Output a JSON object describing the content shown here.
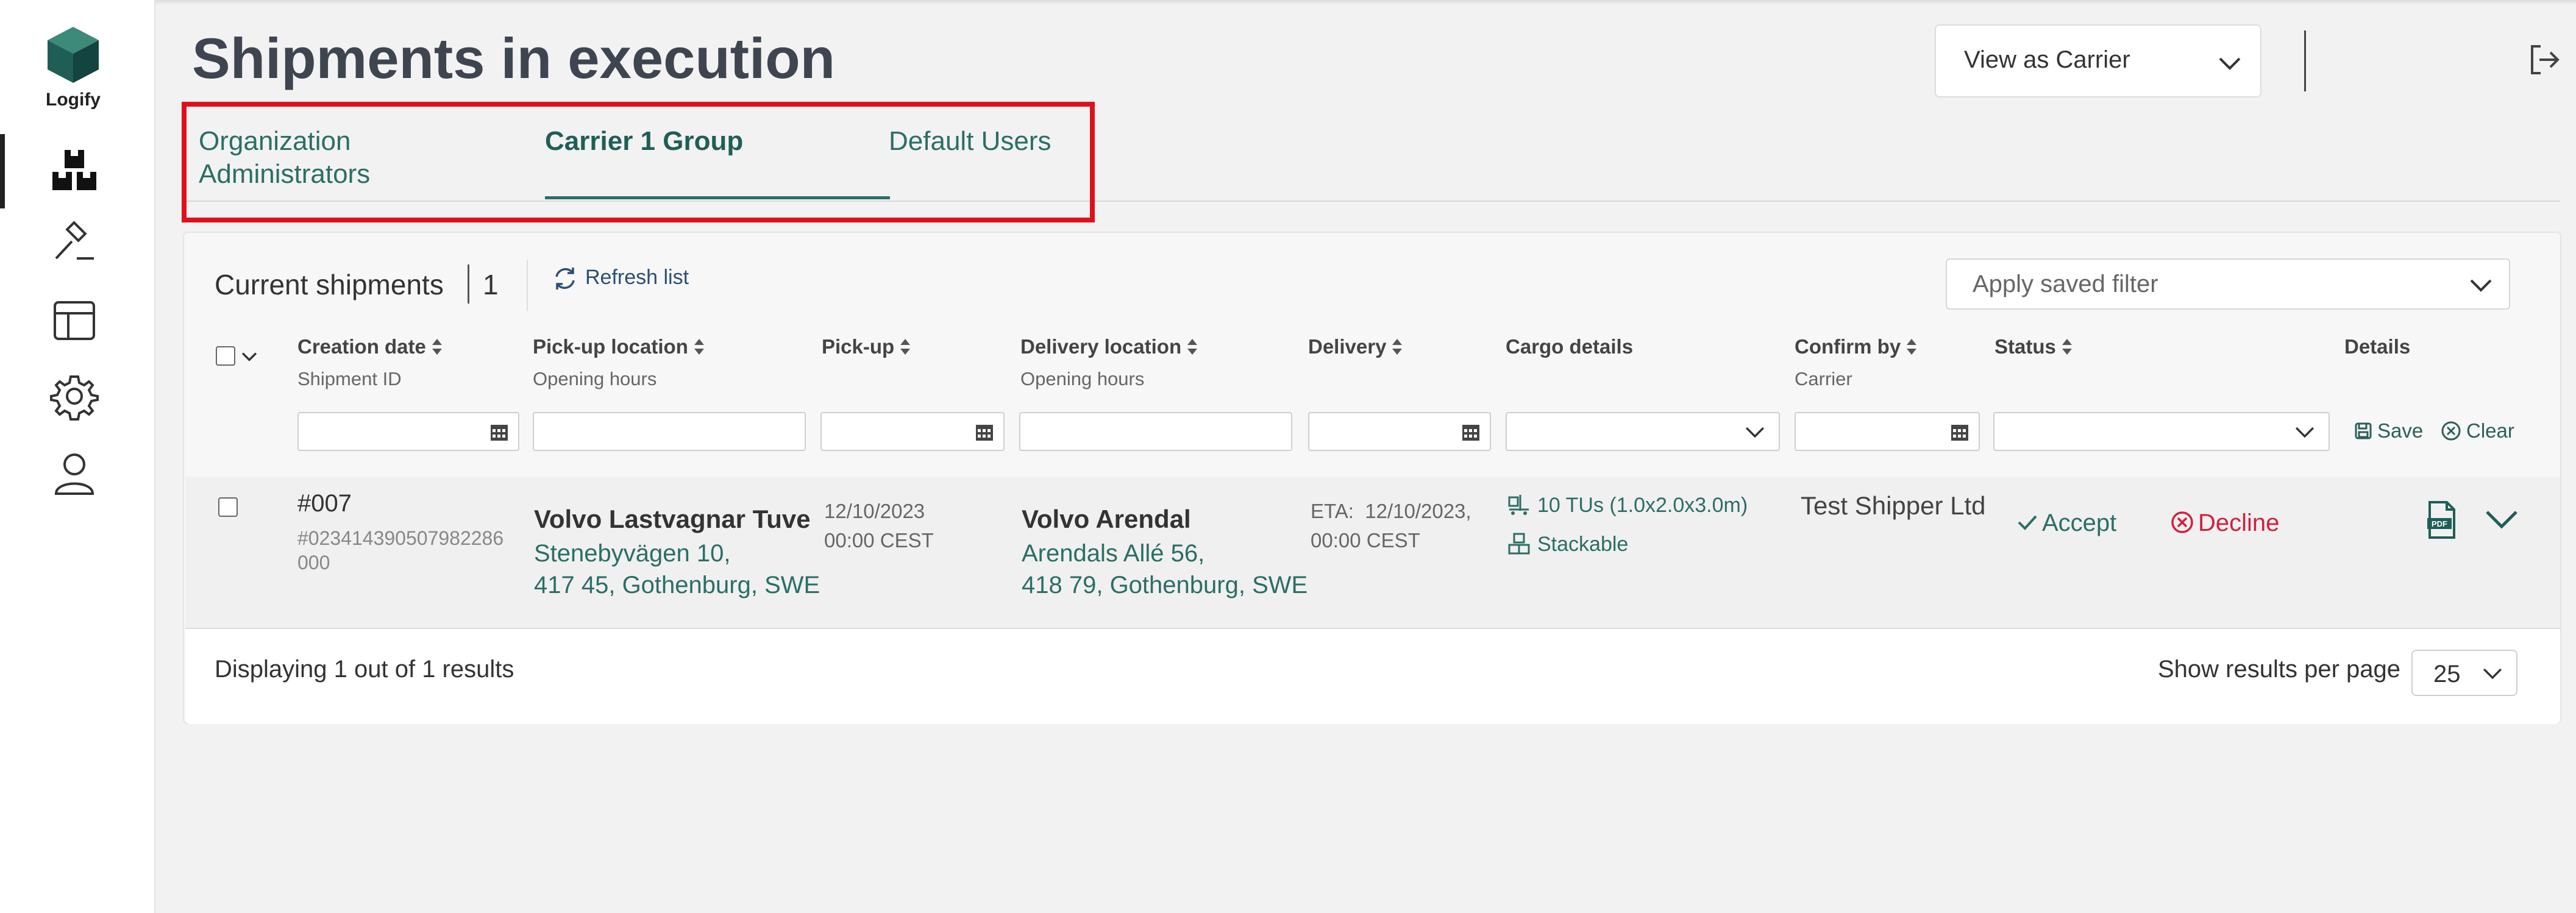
{
  "app": {
    "logo_text": "Logify"
  },
  "page": {
    "title": "Shipments in execution"
  },
  "view_select": {
    "value": "View as Carrier"
  },
  "tabs": [
    {
      "label": "Organization Administrators",
      "active": false
    },
    {
      "label": "Carrier 1 Group",
      "active": true
    },
    {
      "label": "Default Users",
      "active": false
    }
  ],
  "shipments": {
    "current_label": "Current shipments",
    "count": "1",
    "refresh_label": "Refresh list",
    "saved_filter_placeholder": "Apply saved filter",
    "columns": {
      "creation_date": "Creation date",
      "shipment_id": "Shipment ID",
      "pickup_location": "Pick-up location",
      "pickup_hours": "Opening hours",
      "pickup": "Pick-up",
      "delivery_location": "Delivery location",
      "delivery_hours": "Opening hours",
      "delivery": "Delivery",
      "cargo": "Cargo details",
      "confirm_by": "Confirm by",
      "carrier": "Carrier",
      "status": "Status",
      "details": "Details"
    },
    "filter_actions": {
      "save": "Save",
      "clear": "Clear"
    },
    "rows": [
      {
        "id": "#007",
        "shipment_id_line1": "#023414390507982286",
        "shipment_id_line2": "000",
        "pickup_name": "Volvo Lastvagnar Tuve",
        "pickup_addr1": "Stenebyvägen 10,",
        "pickup_addr2": "417 45, Gothenburg, SWE",
        "pickup_date": "12/10/2023",
        "pickup_time": "00:00 CEST",
        "delivery_name": "Volvo Arendal",
        "delivery_addr1": "Arendals Allé 56,",
        "delivery_addr2": "418 79, Gothenburg, SWE",
        "delivery_eta": "ETA:  12/10/2023,",
        "delivery_time": "00:00 CEST",
        "cargo_units": "10 TUs (1.0x2.0x3.0m)",
        "cargo_stack": "Stackable",
        "confirm_by": "Test Shipper Ltd",
        "accept": "Accept",
        "decline": "Decline"
      }
    ],
    "footer": {
      "displaying": "Displaying 1 out of 1 results",
      "per_page_label": "Show results per page",
      "per_page_value": "25"
    }
  },
  "colors": {
    "accent": "#2b6e66",
    "danger": "#d2203c",
    "highlight": "#e0101b"
  }
}
